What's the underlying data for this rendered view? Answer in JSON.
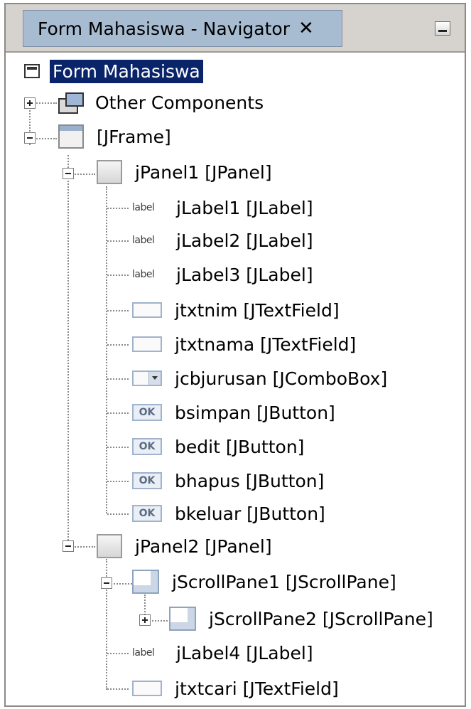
{
  "window": {
    "tab_title": "Form Mahasiswa - Navigator",
    "close_glyph": "✕"
  },
  "tree": {
    "root": "Form Mahasiswa",
    "other_components": "Other Components",
    "jframe": "[JFrame]",
    "jpanel1": "jPanel1 [JPanel]",
    "jpanel1_children": [
      {
        "label": "jLabel1 [JLabel]",
        "icon": "label-icon"
      },
      {
        "label": "jLabel2 [JLabel]",
        "icon": "label-icon"
      },
      {
        "label": "jLabel3 [JLabel]",
        "icon": "label-icon"
      },
      {
        "label": "jtxtnim [JTextField]",
        "icon": "textfield-icon"
      },
      {
        "label": "jtxtnama [JTextField]",
        "icon": "textfield-icon"
      },
      {
        "label": "jcbjurusan [JComboBox]",
        "icon": "combobox-icon"
      },
      {
        "label": "bsimpan [JButton]",
        "icon": "button-icon"
      },
      {
        "label": "bedit [JButton]",
        "icon": "button-icon"
      },
      {
        "label": "bhapus [JButton]",
        "icon": "button-icon"
      },
      {
        "label": "bkeluar [JButton]",
        "icon": "button-icon"
      }
    ],
    "jpanel2": "jPanel2 [JPanel]",
    "jscrollpane1": "jScrollPane1 [JScrollPane]",
    "jscrollpane2": "jScrollPane2 [JScrollPane]",
    "jlabel4": "jLabel4 [JLabel]",
    "jtxtcari": "jtxtcari [JTextField]",
    "label_icon_text": "label",
    "button_icon_text": "OK"
  },
  "colors": {
    "selection": "#0a246a",
    "tab_active": "#a7bbd1",
    "titlebar": "#d6d3ce"
  }
}
